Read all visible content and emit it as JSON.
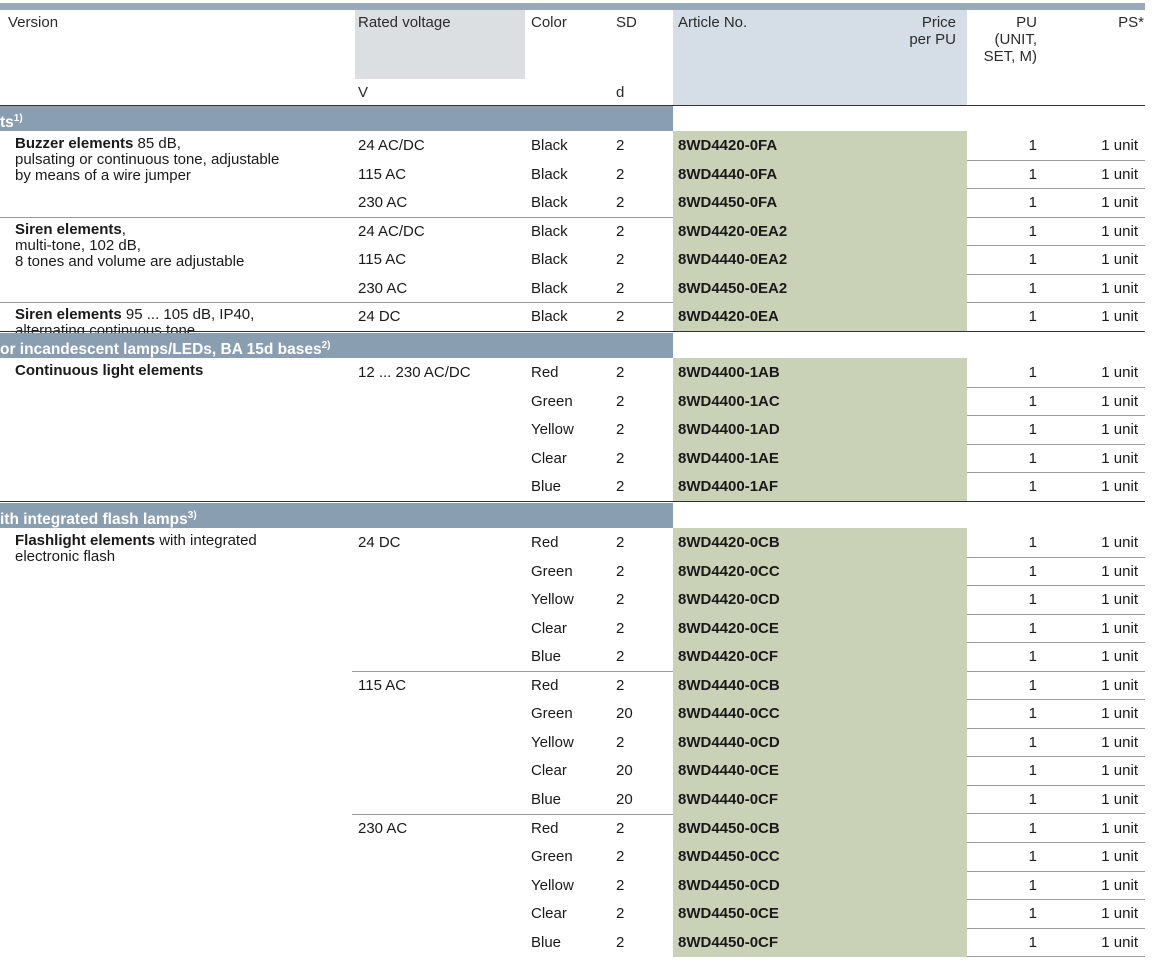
{
  "colors": {
    "header_bar": "#9aa8b8",
    "header_gray": "#dcdfe2",
    "header_blue": "#d5dee6",
    "section_band": "#8a9eb1",
    "article_green": "#c9d2b7"
  },
  "header": {
    "version": "Version",
    "rated_voltage": "Rated voltage",
    "color": "Color",
    "sd": "SD",
    "article_no": "Article No.",
    "price_line1": "Price",
    "price_line2": "per PU",
    "pu_line1": "PU",
    "pu_line2": "(UNIT,",
    "pu_line3": "SET, M)",
    "ps": "PS*",
    "unit_v": "V",
    "unit_d": "d"
  },
  "sections": [
    {
      "title": "ts",
      "footnote": "1)",
      "groups": [
        {
          "name_bold": "Buzzer elements",
          "lines": [
            " 85 dB,",
            "pulsating or continuous tone, adjustable",
            "by means of a wire jumper"
          ],
          "rows": [
            {
              "voltage": "24 AC/DC",
              "color": "Black",
              "sd": "2",
              "article": "8WD4420-0FA",
              "pu": "1",
              "ps": "1 unit"
            },
            {
              "voltage": "115 AC",
              "color": "Black",
              "sd": "2",
              "article": "8WD4440-0FA",
              "pu": "1",
              "ps": "1 unit"
            },
            {
              "voltage": "230 AC",
              "color": "Black",
              "sd": "2",
              "article": "8WD4450-0FA",
              "pu": "1",
              "ps": "1 unit"
            }
          ]
        },
        {
          "name_bold": "Siren elements",
          "lines": [
            ",",
            "multi-tone, 102 dB,",
            "8 tones and volume are adjustable"
          ],
          "rows": [
            {
              "voltage": "24 AC/DC",
              "color": "Black",
              "sd": "2",
              "article": "8WD4420-0EA2",
              "pu": "1",
              "ps": "1 unit"
            },
            {
              "voltage": "115 AC",
              "color": "Black",
              "sd": "2",
              "article": "8WD4440-0EA2",
              "pu": "1",
              "ps": "1 unit"
            },
            {
              "voltage": "230 AC",
              "color": "Black",
              "sd": "2",
              "article": "8WD4450-0EA2",
              "pu": "1",
              "ps": "1 unit"
            }
          ]
        },
        {
          "name_bold": "Siren elements",
          "lines": [
            " 95 ... 105 dB, IP40,",
            "alternating continuous tone"
          ],
          "rows": [
            {
              "voltage": "24 DC",
              "color": "Black",
              "sd": "2",
              "article": "8WD4420-0EA",
              "pu": "1",
              "ps": "1 unit"
            }
          ]
        }
      ]
    },
    {
      "title": "or incandescent lamps/LEDs, BA 15d bases",
      "footnote": "2)",
      "groups": [
        {
          "name_bold": "Continuous light elements",
          "lines": [],
          "rows": [
            {
              "voltage": "12 ... 230 AC/DC",
              "color": "Red",
              "sd": "2",
              "article": "8WD4400-1AB",
              "pu": "1",
              "ps": "1 unit"
            },
            {
              "voltage": "",
              "color": "Green",
              "sd": "2",
              "article": "8WD4400-1AC",
              "pu": "1",
              "ps": "1 unit"
            },
            {
              "voltage": "",
              "color": "Yellow",
              "sd": "2",
              "article": "8WD4400-1AD",
              "pu": "1",
              "ps": "1 unit"
            },
            {
              "voltage": "",
              "color": "Clear",
              "sd": "2",
              "article": "8WD4400-1AE",
              "pu": "1",
              "ps": "1 unit"
            },
            {
              "voltage": "",
              "color": "Blue",
              "sd": "2",
              "article": "8WD4400-1AF",
              "pu": "1",
              "ps": "1 unit"
            }
          ]
        }
      ]
    },
    {
      "title": "ith integrated flash lamps",
      "footnote": "3)",
      "groups": [
        {
          "name_bold": "Flashlight elements",
          "lines": [
            " with integrated",
            "electronic flash"
          ],
          "rows": [
            {
              "voltage": "24 DC",
              "color": "Red",
              "sd": "2",
              "article": "8WD4420-0CB",
              "pu": "1",
              "ps": "1 unit"
            },
            {
              "voltage": "",
              "color": "Green",
              "sd": "2",
              "article": "8WD4420-0CC",
              "pu": "1",
              "ps": "1 unit"
            },
            {
              "voltage": "",
              "color": "Yellow",
              "sd": "2",
              "article": "8WD4420-0CD",
              "pu": "1",
              "ps": "1 unit"
            },
            {
              "voltage": "",
              "color": "Clear",
              "sd": "2",
              "article": "8WD4420-0CE",
              "pu": "1",
              "ps": "1 unit"
            },
            {
              "voltage": "",
              "color": "Blue",
              "sd": "2",
              "article": "8WD4420-0CF",
              "pu": "1",
              "ps": "1 unit"
            },
            {
              "voltage": "115 AC",
              "color": "Red",
              "sd": "2",
              "article": "8WD4440-0CB",
              "pu": "1",
              "ps": "1 unit"
            },
            {
              "voltage": "",
              "color": "Green",
              "sd": "20",
              "article": "8WD4440-0CC",
              "pu": "1",
              "ps": "1 unit"
            },
            {
              "voltage": "",
              "color": "Yellow",
              "sd": "2",
              "article": "8WD4440-0CD",
              "pu": "1",
              "ps": "1 unit"
            },
            {
              "voltage": "",
              "color": "Clear",
              "sd": "20",
              "article": "8WD4440-0CE",
              "pu": "1",
              "ps": "1 unit"
            },
            {
              "voltage": "",
              "color": "Blue",
              "sd": "20",
              "article": "8WD4440-0CF",
              "pu": "1",
              "ps": "1 unit"
            },
            {
              "voltage": "230 AC",
              "color": "Red",
              "sd": "2",
              "article": "8WD4450-0CB",
              "pu": "1",
              "ps": "1 unit"
            },
            {
              "voltage": "",
              "color": "Green",
              "sd": "2",
              "article": "8WD4450-0CC",
              "pu": "1",
              "ps": "1 unit"
            },
            {
              "voltage": "",
              "color": "Yellow",
              "sd": "2",
              "article": "8WD4450-0CD",
              "pu": "1",
              "ps": "1 unit"
            },
            {
              "voltage": "",
              "color": "Clear",
              "sd": "2",
              "article": "8WD4450-0CE",
              "pu": "1",
              "ps": "1 unit"
            },
            {
              "voltage": "",
              "color": "Blue",
              "sd": "2",
              "article": "8WD4450-0CF",
              "pu": "1",
              "ps": "1 unit"
            }
          ]
        }
      ]
    }
  ]
}
